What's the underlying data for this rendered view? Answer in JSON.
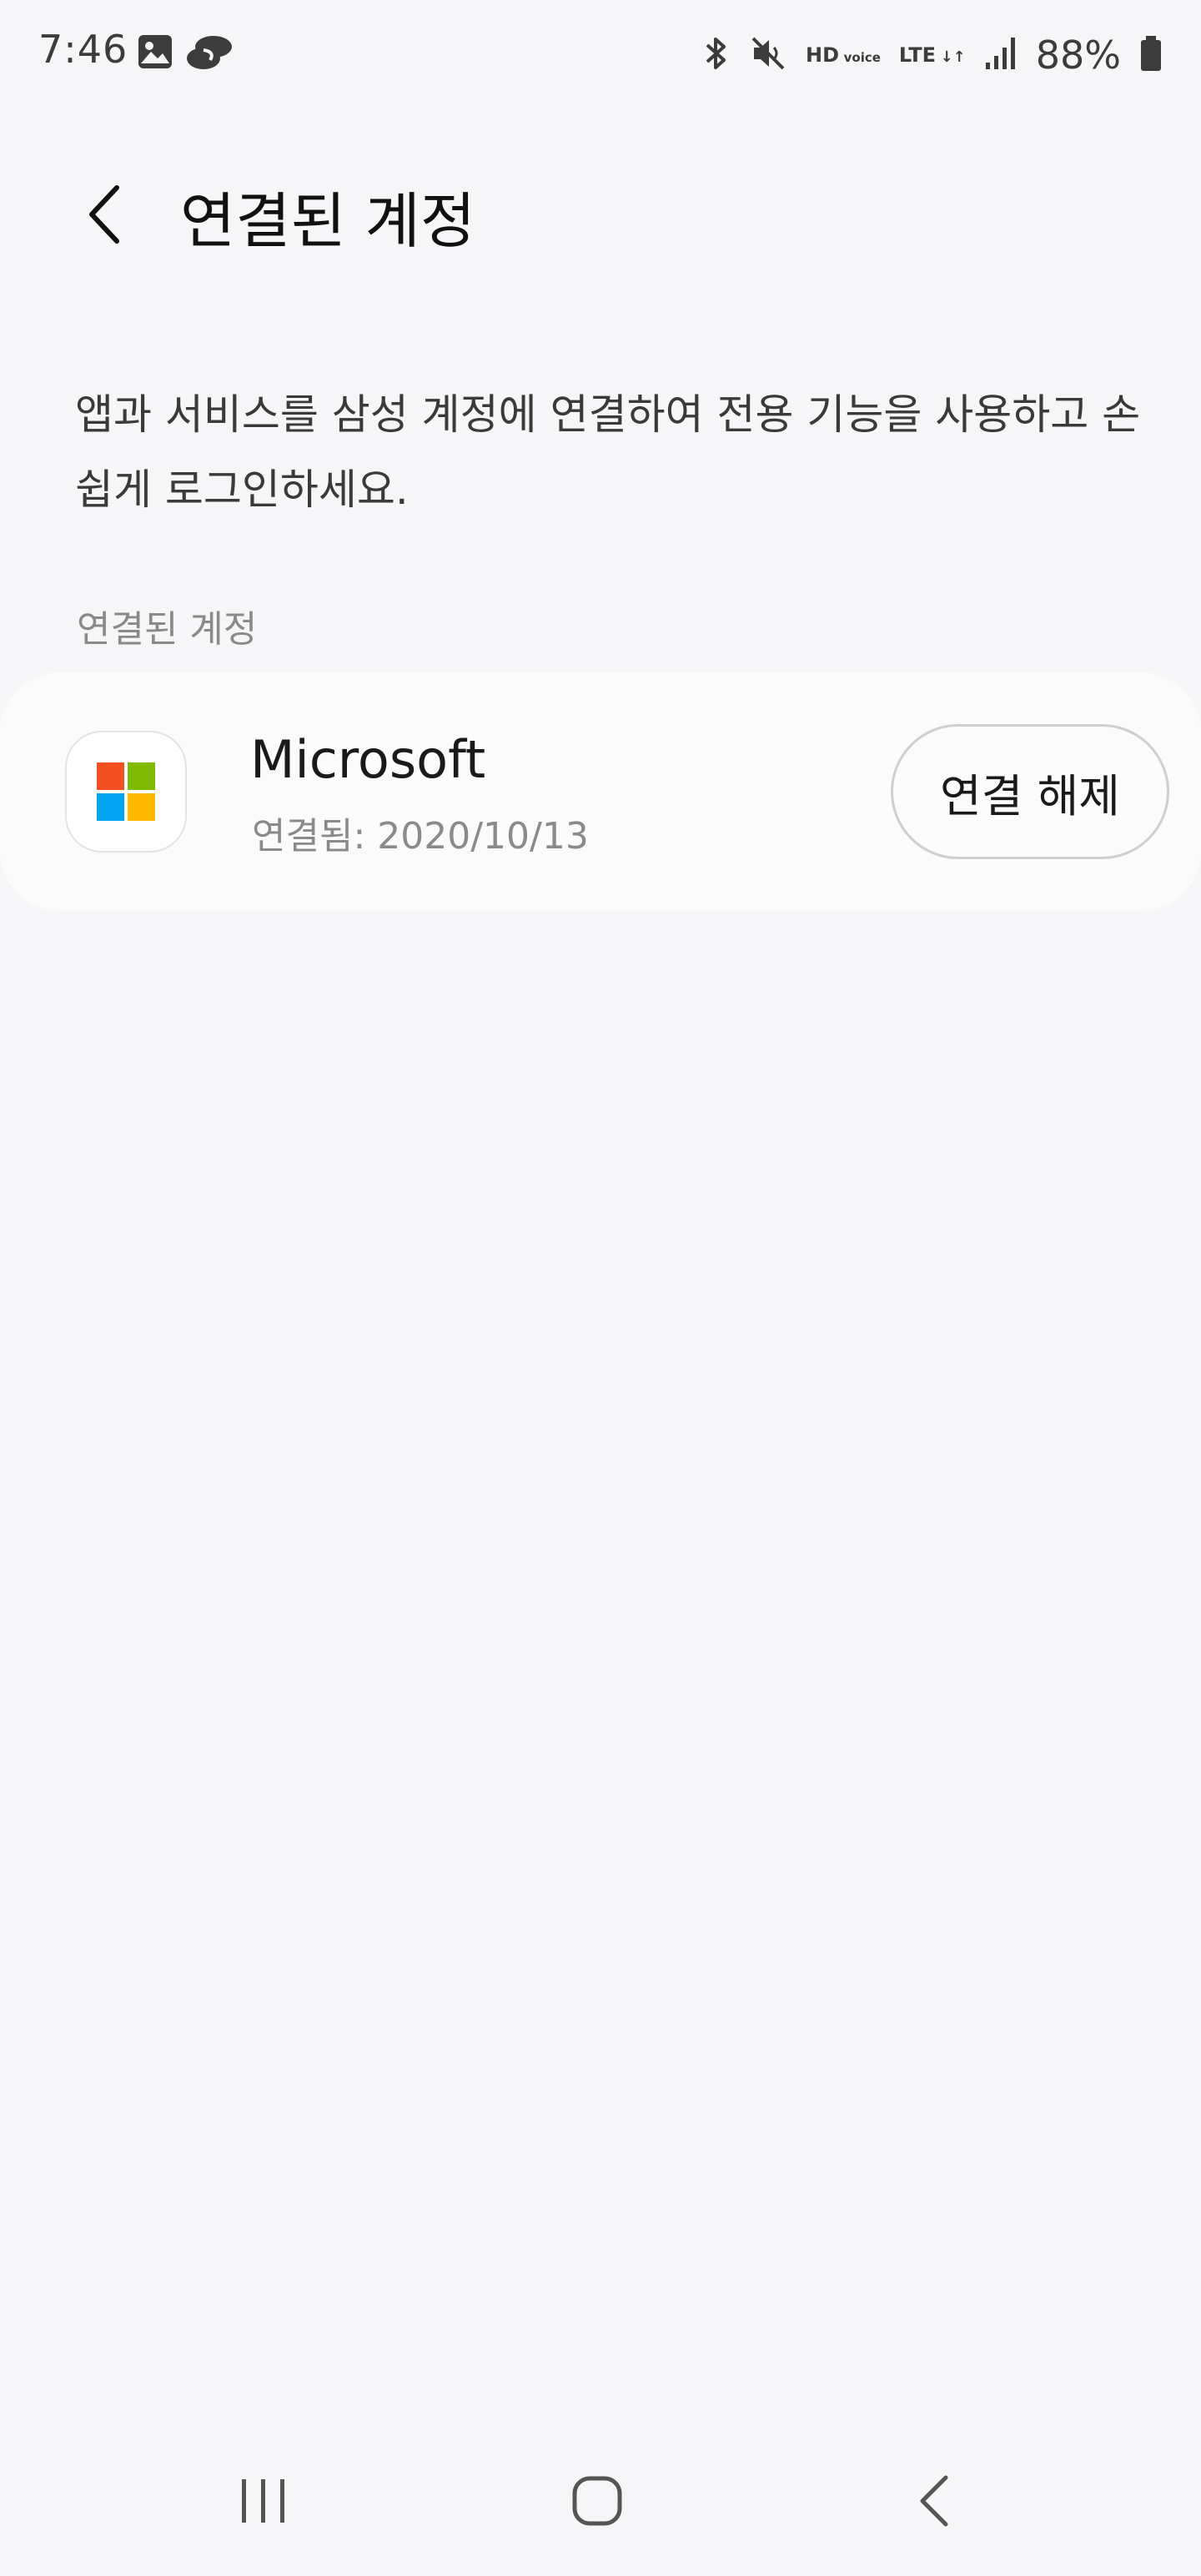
{
  "status_bar": {
    "time": "7:46",
    "battery": "88%",
    "left_icons": [
      "image-icon",
      "sync-app-icon"
    ],
    "right_icons": [
      "bluetooth-icon",
      "mute-icon",
      "hd-voice-icon",
      "lte-icon",
      "signal-icon",
      "battery-icon"
    ],
    "hd_label": "HD",
    "voice_label": "voice",
    "lte_label": "LTE",
    "lte_arrows": "↓↑"
  },
  "header": {
    "title": "연결된 계정",
    "back_icon": "chevron-left-icon"
  },
  "description": "앱과 서비스를 삼성 계정에 연결하여 전용 기능을 사용하고 손쉽게 로그인하세요.",
  "section": {
    "label": "연결된 계정"
  },
  "accounts": [
    {
      "name": "Microsoft",
      "connected": "연결됨: 2020/10/13",
      "action_label": "연결 해제",
      "icon": "microsoft-logo-icon"
    }
  ],
  "colors": {
    "background": "#f6f6f8",
    "card": "#fbfbfb",
    "ms_red": "#f25022",
    "ms_green": "#7fba00",
    "ms_blue": "#00a4ef",
    "ms_yellow": "#ffb900"
  },
  "nav_bar": {
    "icons": [
      "recent-apps-icon",
      "home-icon",
      "back-icon"
    ]
  }
}
